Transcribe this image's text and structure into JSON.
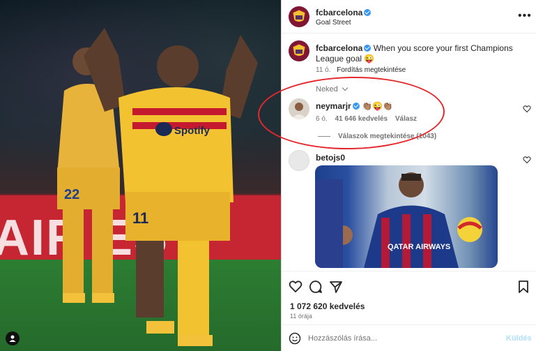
{
  "post": {
    "account": "fcbarcelona",
    "location": "Goal Street",
    "caption_user": "fcbarcelona",
    "caption_text": "When you score your first Champions League goal 😜",
    "caption_time": "11 ó.",
    "translate_label": "Fordítás megtekintése",
    "filter_label": "Neked",
    "likes": "1 072 620 kedvelés",
    "post_time": "11 órája"
  },
  "comments": [
    {
      "user": "neymarjr",
      "text": "👏🏽😜👏🏽",
      "time": "6 ó.",
      "likes": "41 646 kedvelés",
      "reply_label": "Válasz",
      "view_replies": "Válaszok megtekintése (1043)"
    },
    {
      "user": "betojs0"
    }
  ],
  "photo": {
    "ad_text": "AIR ES",
    "player_number": "11",
    "player_number_bg": "22",
    "sponsor": "Spotify"
  },
  "comment_input": {
    "placeholder": "Hozzászólás írása...",
    "send_label": "Küldés"
  },
  "post_image": {
    "sponsor": "QATAR AIRWAYS"
  },
  "colors": {
    "annotation": "#e5282d",
    "verified": "#3897f0",
    "barca_gold": "#f2c230"
  }
}
